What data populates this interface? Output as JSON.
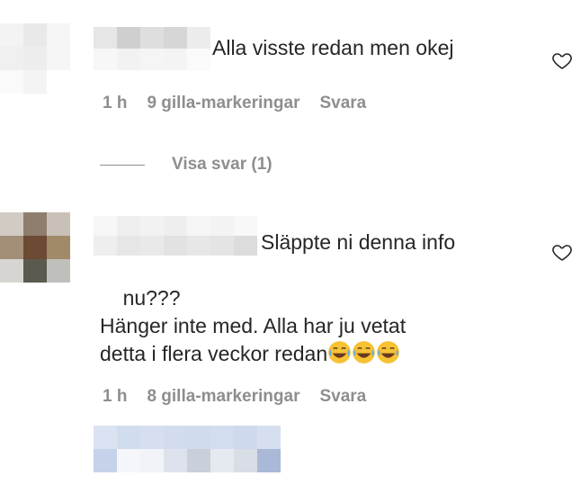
{
  "comments": [
    {
      "text": "Alla visste redan men okej",
      "time": "1 h",
      "likes": "9 gilla-markeringar",
      "reply_label": "Svara",
      "view_replies_label": "Visa svar (1)"
    },
    {
      "text_line1": "Släppte ni denna info",
      "text_rest": "nu???\nHänger inte med. Alla har ju vetat\ndetta i flera veckor redan",
      "emojis": [
        "face-with-tears-of-joy-icon",
        "face-with-tears-of-joy-icon",
        "face-with-tears-of-joy-icon"
      ],
      "time": "1 h",
      "likes": "8 gilla-markeringar",
      "reply_label": "Svara"
    }
  ],
  "colors": {
    "text": "#262626",
    "meta": "#8e8e8e",
    "emoji_face": "#f7c233"
  }
}
